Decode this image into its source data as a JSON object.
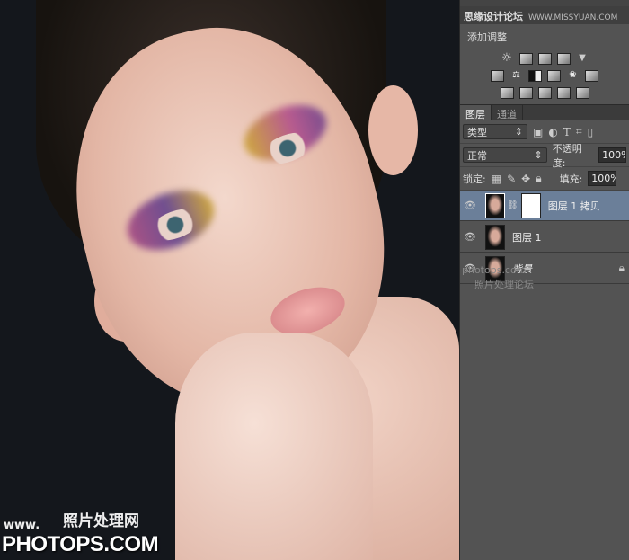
{
  "canvas": {
    "watermark_bottom_small": "www.",
    "watermark_bottom_cn": "照片处理网",
    "watermark_bottom_big": "PHOTOPS.COM"
  },
  "panel": {
    "watermark_top_cn": "思缘设计论坛",
    "watermark_top_url": "WWW.MISSYUAN.COM",
    "adjustments_title": "添加调整",
    "adjust_icons_row1": [
      "brightness-icon",
      "levels-icon",
      "curves-icon",
      "exposure-icon",
      "vibrance-icon"
    ],
    "adjust_icons_row2": [
      "hue-saturation-icon",
      "color-balance-icon",
      "black-white-icon",
      "photo-filter-icon",
      "channel-mixer-icon",
      "color-lookup-icon"
    ],
    "adjust_icons_row3": [
      "invert-icon",
      "posterize-icon",
      "threshold-icon",
      "selective-color-icon",
      "gradient-map-icon"
    ],
    "tabs": [
      {
        "label": "图层",
        "active": true
      },
      {
        "label": "通道",
        "active": false
      }
    ],
    "filter_kind": "类型",
    "blend_mode": "正常",
    "opacity_label": "不透明度:",
    "opacity_value": "100%",
    "lock_label": "锁定:",
    "fill_label": "填充:",
    "fill_value": "100%",
    "layers": [
      {
        "name": "图层 1 拷贝",
        "selected": true,
        "visible": true,
        "has_mask": true
      },
      {
        "name": "图层 1",
        "selected": false,
        "visible": true
      },
      {
        "name": "背景",
        "selected": false,
        "visible": true,
        "locked": true
      }
    ],
    "watermark_layers_url": "photops.com",
    "watermark_layers_cn": "照片处理论坛"
  }
}
